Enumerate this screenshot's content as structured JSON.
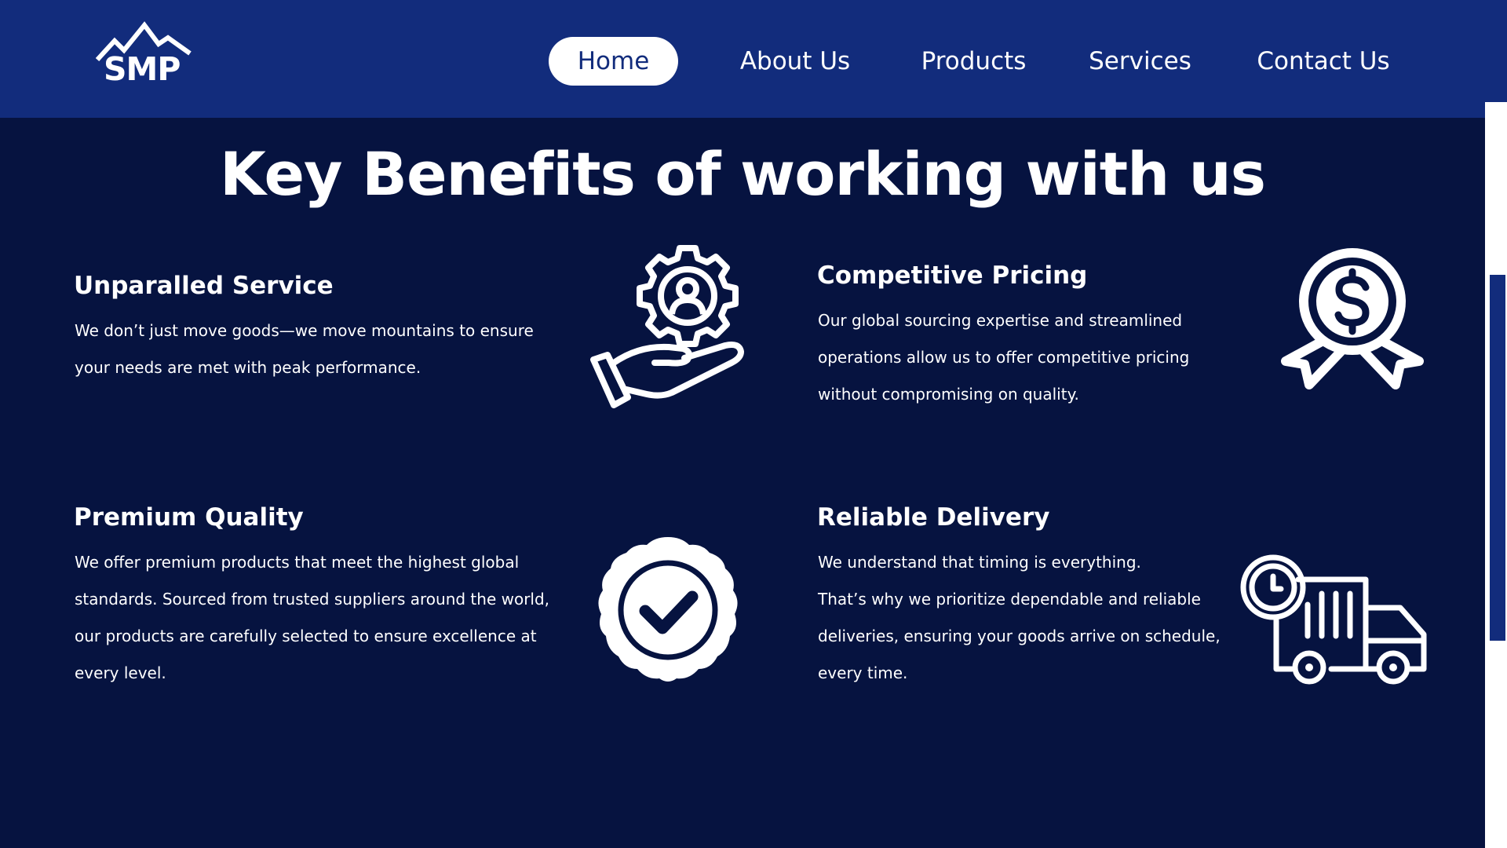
{
  "header": {
    "logo_text": "SMP",
    "nav": [
      {
        "label": "Home",
        "active": true
      },
      {
        "label": "About Us",
        "active": false
      },
      {
        "label": "Products",
        "active": false
      },
      {
        "label": "Services",
        "active": false
      },
      {
        "label": "Contact Us",
        "active": false
      }
    ]
  },
  "main": {
    "title": "Key Benefits of working with us",
    "benefits": [
      {
        "title": "Unparalled Service",
        "lines": [
          "We don’t just move goods—we move mountains to ensure",
          "your  needs are met with peak performance."
        ],
        "icon": "hand-gear-user-icon"
      },
      {
        "title": "Competitive Pricing",
        "lines": [
          "Our global sourcing expertise and streamlined",
          "operations allow us to offer competitive pricing",
          "without compromising on quality."
        ],
        "icon": "dollar-badge-icon"
      },
      {
        "title": "Premium Quality",
        "lines": [
          "We offer premium products that meet the highest global",
          "standards. Sourced from trusted  suppliers around the world,",
          "our products are carefully selected to ensure excellence at",
          "every level."
        ],
        "icon": "check-seal-icon"
      },
      {
        "title": "Reliable Delivery",
        "lines": [
          "We understand that timing is everything.",
          "That’s why we prioritize dependable and reliable",
          "deliveries, ensuring your goods arrive on schedule,",
          "every time."
        ],
        "icon": "delivery-truck-clock-icon"
      }
    ]
  },
  "colors": {
    "header_bg": "#122c7c",
    "page_bg": "#061340",
    "text": "#ffffff"
  }
}
